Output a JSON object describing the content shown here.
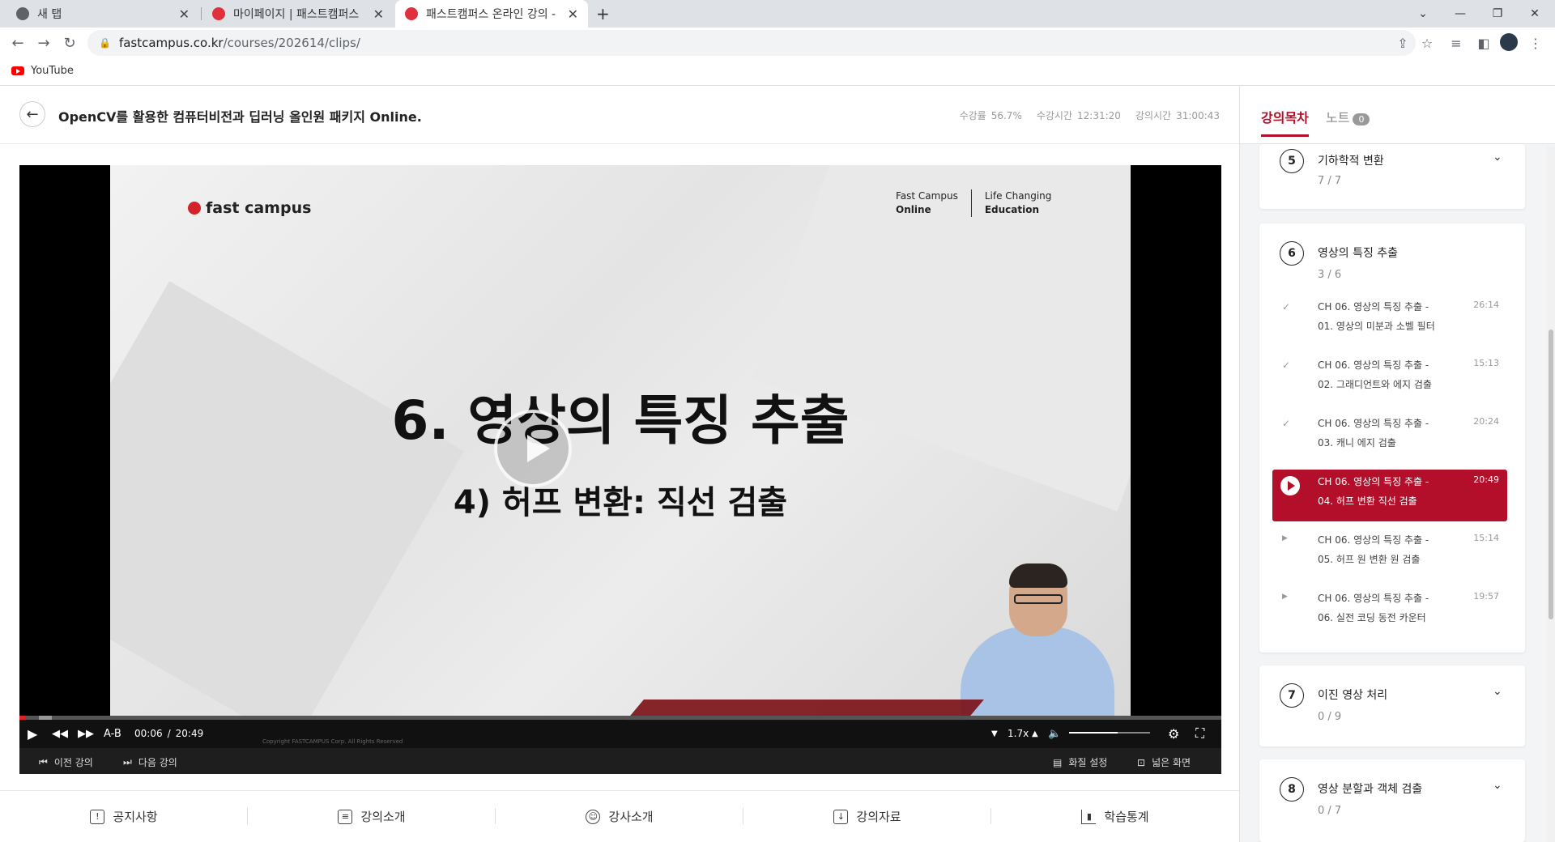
{
  "browser": {
    "tabs": [
      {
        "title": "새 탭"
      },
      {
        "title": "마이페이지 | 패스트캠퍼스"
      },
      {
        "title": "패스트캠퍼스 온라인 강의 -"
      }
    ],
    "new_tab_icon": "+",
    "url_host": "fastcampus.co.kr",
    "url_path": "/courses/202614/clips/",
    "bookmark": "YouTube"
  },
  "course": {
    "title": "OpenCV를 활용한 컴퓨터비전과 딥러닝 올인원 패키지 Online.",
    "stats": [
      {
        "label": "수강률",
        "value": "56.7%"
      },
      {
        "label": "수강시간",
        "value": "12:31:20"
      },
      {
        "label": "강의시간",
        "value": "31:00:43"
      }
    ]
  },
  "slide": {
    "logo": "fast campus",
    "right_a1": "Fast Campus",
    "right_a2": "Online",
    "right_b1": "Life Changing",
    "right_b2": "Education",
    "title": "6. 영상의 특징 추출",
    "subtitle": "4) 허프 변환: 직선 검출",
    "copyright": "Copyright FASTCAMPUS Corp. All Rights Reserved"
  },
  "player": {
    "ab": "A-B",
    "current_time": "00:06",
    "separator": "/",
    "duration": "20:49",
    "progress_fraction": 0.005,
    "speed": "1.7x",
    "volume_fraction": 0.6,
    "prev": "이전 강의",
    "next": "다음 강의",
    "quality": "화질 설정",
    "wide": "넓은 화면"
  },
  "bottom_nav": [
    "공지사항",
    "강의소개",
    "강사소개",
    "강의자료",
    "학습통계"
  ],
  "sidebar": {
    "tab_toc": "강의목차",
    "tab_note": "노트",
    "note_count": "0",
    "chapters": [
      {
        "num": "5",
        "title": "기하학적 변환",
        "count": "7 / 7"
      },
      {
        "num": "6",
        "title": "영상의 특징 추출",
        "count": "3 / 6"
      },
      {
        "num": "7",
        "title": "이진 영상 처리",
        "count": "0 / 9"
      },
      {
        "num": "8",
        "title": "영상 분할과 객체 검출",
        "count": "0 / 7"
      }
    ],
    "lectures": [
      {
        "line1": "CH 06. 영상의 특징 추출 -",
        "line2": "01. 영상의 미분과 소벨 필터",
        "time": "26:14",
        "status": "done"
      },
      {
        "line1": "CH 06. 영상의 특징 추출 -",
        "line2": "02. 그래디언트와 에지 검출",
        "time": "15:13",
        "status": "done"
      },
      {
        "line1": "CH 06. 영상의 특징 추출 -",
        "line2": "03. 캐니 에지 검출",
        "time": "20:24",
        "status": "done"
      },
      {
        "line1": "CH 06. 영상의 특징 추출 -",
        "line2": "04. 허프 변환 직선 검출",
        "time": "20:49",
        "status": "current"
      },
      {
        "line1": "CH 06. 영상의 특징 추출 -",
        "line2": "05. 허프 원 변환 원 검출",
        "time": "15:14",
        "status": "todo"
      },
      {
        "line1": "CH 06. 영상의 특징 추출 -",
        "line2": "06. 실전 코딩 동전 카운터",
        "time": "19:57",
        "status": "todo"
      }
    ]
  }
}
